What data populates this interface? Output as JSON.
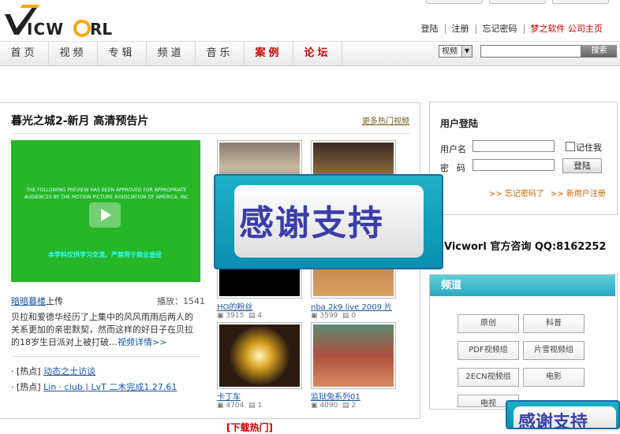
{
  "header": {
    "logo_text": "VicWorl",
    "top_links": [
      "登陆",
      "注册",
      "忘记密码",
      "梦之软件 公司主页"
    ]
  },
  "nav": [
    "首页",
    "视频",
    "专辑",
    "频道",
    "音乐",
    "案例",
    "论坛"
  ],
  "search": {
    "select_value": "视频",
    "button": "搜索",
    "placeholder": ""
  },
  "main": {
    "title": "暮光之城2-新月 高清预告片",
    "more_link": "更多热门视频",
    "player_text": "THE FOLLOWING PREVIEW HAS BEEN APPROVED FOR APPROPRIATE AUDIENCES BY THE MOTION PICTURE ASSOCIATION OF AMERICA, INC",
    "player_notice": "本学科仅供学习交流，严禁用于商业途径",
    "uploader": "暗暗暮楼",
    "uploaded": "上传",
    "plays_label": "播放：",
    "plays": "1541",
    "description": "贝拉和爱德华经历了上集中的风风雨雨后两人的关系更加的亲密默契，然而这样的好日子在贝拉的18岁生日派对上被打破…",
    "detail_link": "视频详情>>",
    "hot": [
      {
        "tag": "热点",
        "text": "动态之士访谈"
      },
      {
        "tag": "热点",
        "text": "Lin · club | LvT 二木完成1.27.61"
      }
    ],
    "thumbs": [
      {
        "caption": "HO的粉丝",
        "views": "3915",
        "comments": "4"
      },
      {
        "caption": "nba 2k9 live 2009 片",
        "views": "3599",
        "comments": "0"
      },
      {
        "caption": "卡丁车",
        "views": "4704",
        "comments": "1"
      },
      {
        "caption": "监狱兔系列01",
        "views": "4090",
        "comments": "2"
      }
    ]
  },
  "overlay": {
    "text": "感谢支持"
  },
  "login": {
    "title": "用户登陆",
    "username_label": "用户名",
    "password_label": "密码",
    "remember": "记住我",
    "login_button": "登陆",
    "forgot": ">> 忘记密码了",
    "register": ">> 新用户注册"
  },
  "contact": "Vicworl 官方咨询  QQ:8162252",
  "channels": {
    "title": "频道",
    "items": [
      "原创",
      "科普",
      "PDF视频组",
      "片雪视频组",
      "2ECN视频组",
      "电影",
      "电视",
      ""
    ]
  },
  "bottom": "[下载热门]"
}
